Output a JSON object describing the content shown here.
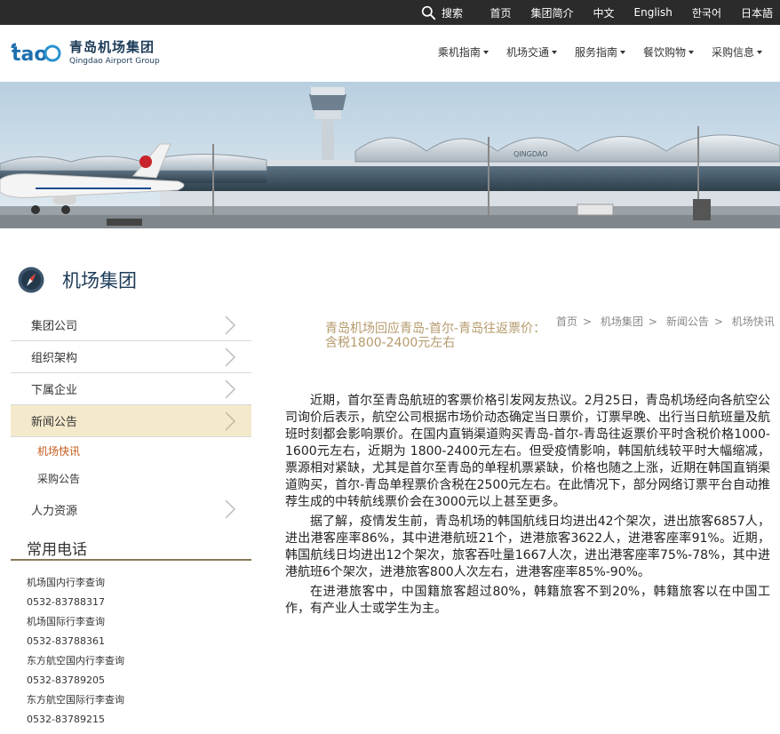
{
  "topbar": {
    "search_label": "搜索",
    "links": [
      "首页",
      "集团简介",
      "中文",
      "English",
      "한국어",
      "日本語"
    ]
  },
  "logo": {
    "mark_text": "tao",
    "name_cn": "青岛机场集团",
    "name_en": "Qingdao Airport Group"
  },
  "mainnav": [
    "乘机指南",
    "机场交通",
    "服务指南",
    "餐饮购物",
    "采购信息"
  ],
  "banner": {
    "terminal_sign": "QINGDAO"
  },
  "sidebar": {
    "title": "机场集团",
    "menu": {
      "group": "集团公司",
      "org": "组织架构",
      "subs": "下属企业",
      "news": "新闻公告",
      "news_express": "机场快讯",
      "purchase": "采购公告",
      "hr": "人力资源"
    },
    "phones_title": "常用电话",
    "phones": [
      "机场国内行李查询",
      "0532-83788317",
      "机场国际行李查询",
      "0532-83788361",
      "东方航空国内行李查询",
      "0532-83789205",
      "东方航空国际行李查询",
      "0532-83789215"
    ]
  },
  "article": {
    "title": "青岛机场回应青岛-首尔-青岛往返票价：含税1800-2400元左右",
    "breadcrumb": [
      "首页",
      "机场集团",
      "新闻公告",
      "机场快讯"
    ],
    "p1": "近期，首尔至青岛航班的客票价格引发网友热议。2月25日，青岛机场经向各航空公司询价后表示，航空公司根据市场价动态确定当日票价，订票早晚、出行当日航班量及航班时刻都会影响票价。在国内直销渠道购买青岛-首尔-青岛往返票价平时含税价格1000-1600元左右，近期为 1800-2400元左右。但受疫情影响，韩国航线较平时大幅缩减，票源相对紧缺，尤其是首尔至青岛的单程机票紧缺，价格也随之上涨，近期在韩国直销渠道购买，首尔-青岛单程票价含税在2500元左右。在此情况下，部分网络订票平台自动推荐生成的中转航线票价会在3000元以上甚至更多。",
    "p2": "据了解，疫情发生前，青岛机场的韩国航线日均进出42个架次，进出旅客6857人，进出港客座率86%，其中进港航班21个，进港旅客3622人，进港客座率91%。近期，韩国航线日均进出12个架次，旅客吞吐量1667人次，进出港客座率75%-78%，其中进港航班6个架次，进港旅客800人次左右，进港客座率85%-90%。",
    "p3": "在进港旅客中，中国籍旅客超过80%，韩籍旅客不到20%，韩籍旅客以在中国工作，有产业人士或学生为主。"
  }
}
